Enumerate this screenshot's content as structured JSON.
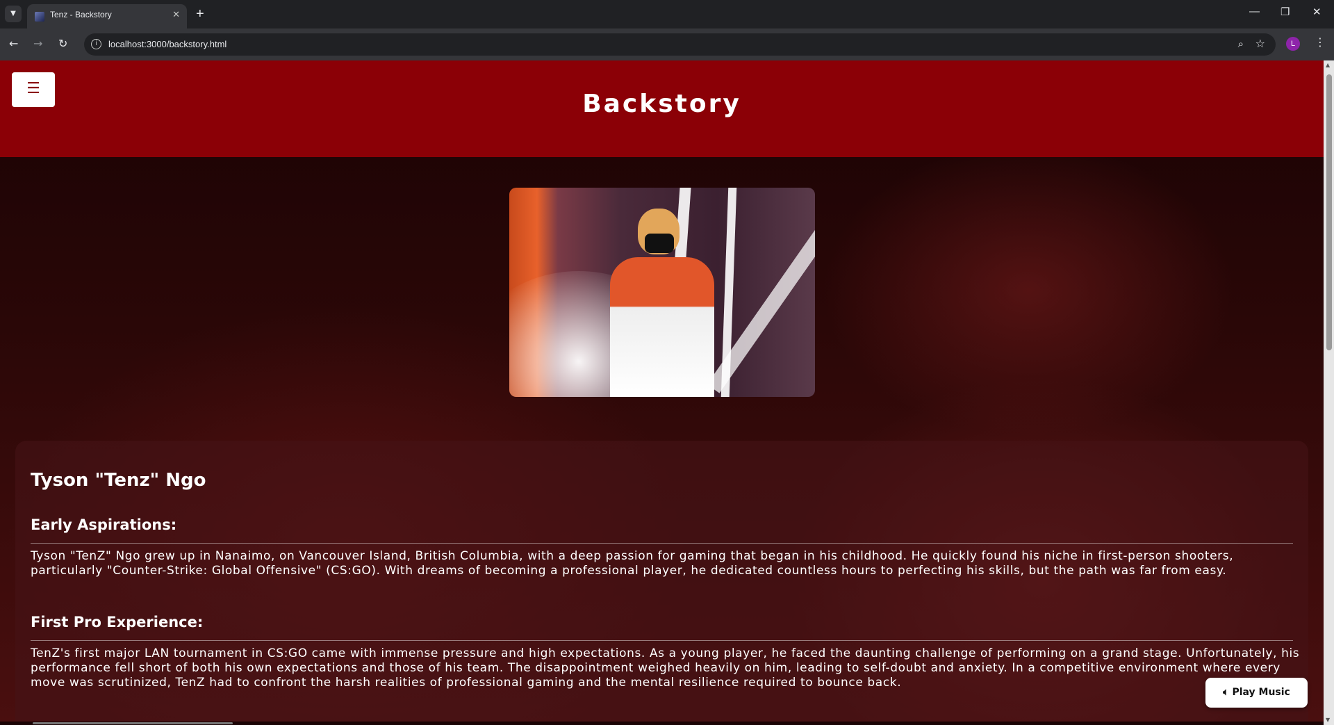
{
  "browser": {
    "tab_title": "Tenz - Backstory",
    "url": "localhost:3000/backstory.html",
    "profile_initial": "L",
    "icons": {
      "tab_menu": "chevron-down-icon",
      "close_tab": "close-icon",
      "new_tab": "plus-icon",
      "back": "arrow-left-icon",
      "forward": "arrow-right-icon",
      "reload": "reload-icon",
      "site_info": "info-icon",
      "zoom": "zoom-icon",
      "bookmark": "star-icon",
      "menu": "kebab-icon"
    }
  },
  "page": {
    "menu_button_icon": "hamburger-icon",
    "title": "Backstory",
    "accent_color": "#8b0006",
    "hero_image_description": "player-photo",
    "person_name": "Tyson \"Tenz\" Ngo",
    "sections": [
      {
        "heading": "Early Aspirations:",
        "text": "Tyson \"TenZ\" Ngo grew up in Nanaimo, on Vancouver Island, British Columbia, with a deep passion for gaming that began in his childhood. He quickly found his niche in first-person shooters, particularly \"Counter-Strike: Global Offensive\" (CS:GO). With dreams of becoming a professional player, he dedicated countless hours to perfecting his skills, but the path was far from easy."
      },
      {
        "heading": "First Pro Experience:",
        "text": "TenZ's first major LAN tournament in CS:GO came with immense pressure and high expectations. As a young player, he faced the daunting challenge of performing on a grand stage. Unfortunately, his performance fell short of both his own expectations and those of his team. The disappointment weighed heavily on him, leading to self-doubt and anxiety. In a competitive environment where every move was scrutinized, TenZ had to confront the harsh realities of professional gaming and the mental resilience required to bounce back."
      }
    ],
    "play_music_label": "Play Music",
    "play_music_icon": "speaker-icon"
  }
}
